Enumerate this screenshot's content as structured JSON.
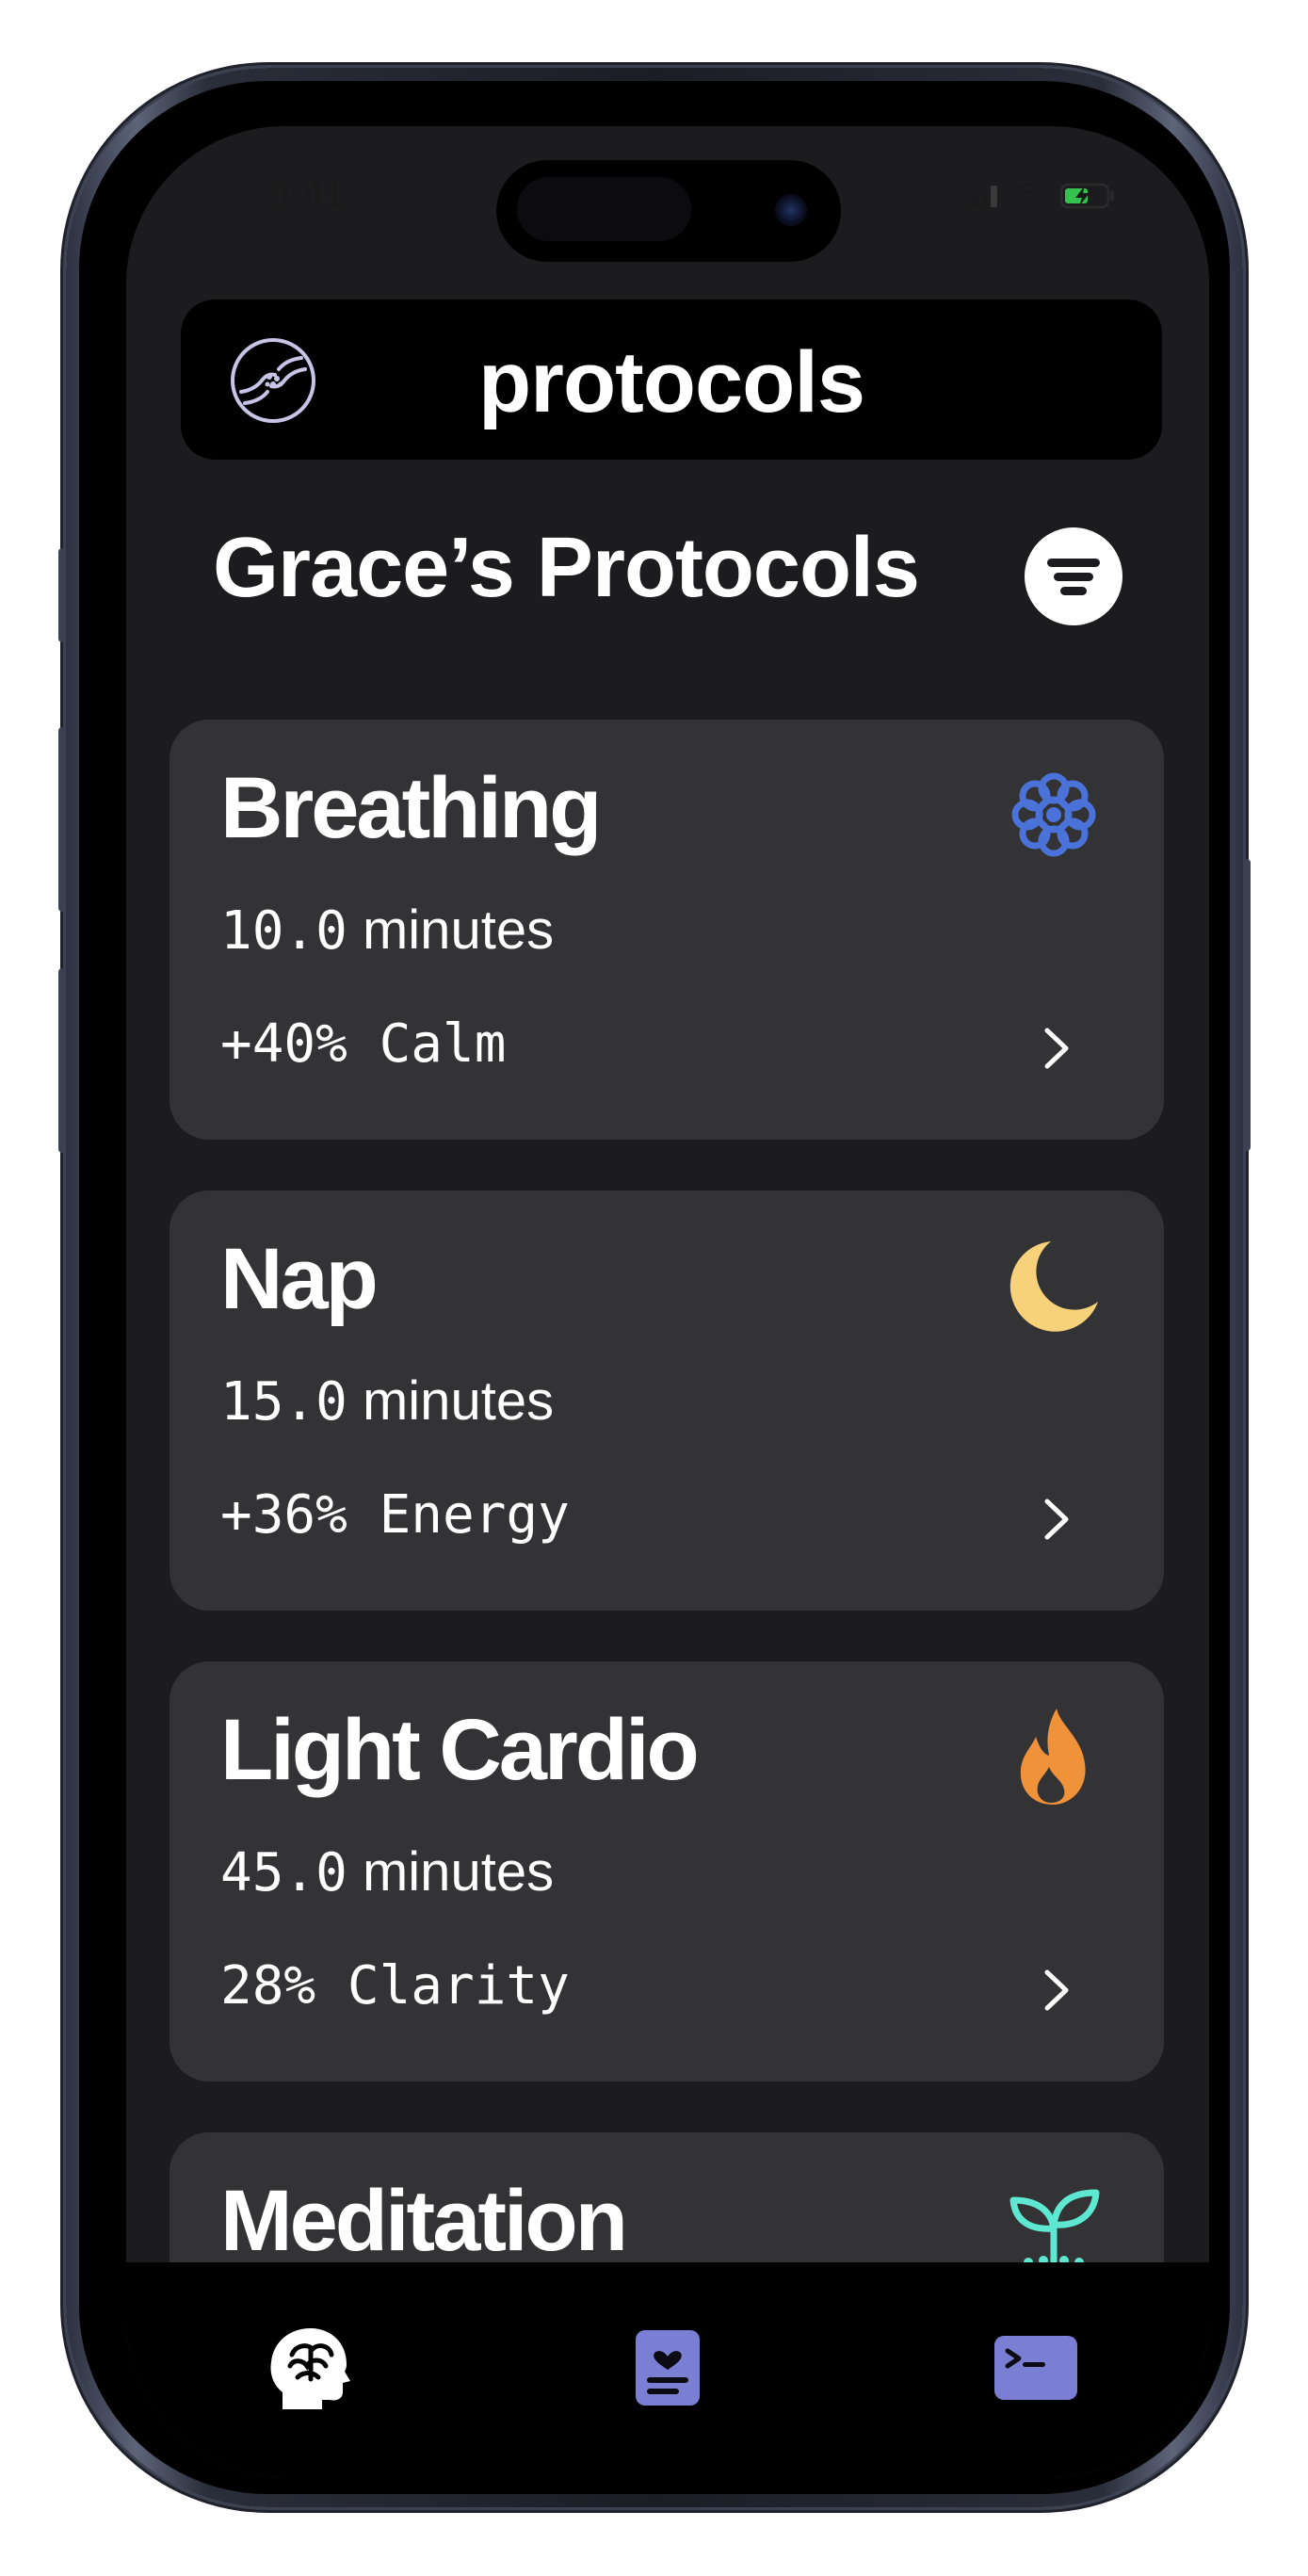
{
  "status_bar": {
    "time": "9:41",
    "icons": [
      "cellular-signal-icon",
      "wifi-icon",
      "battery-charging-icon"
    ]
  },
  "header": {
    "title": "protocols",
    "logo_icon": "brain-hands-logo-icon"
  },
  "page": {
    "title": "Grace’s Protocols",
    "filter_icon": "filter-lines-icon"
  },
  "protocols": [
    {
      "name": "Breathing",
      "duration_value": "10.0",
      "duration_unit": "minutes",
      "effect": "+40% Calm",
      "icon": "flower-icon",
      "icon_color": "#4a72d9"
    },
    {
      "name": "Nap",
      "duration_value": "15.0",
      "duration_unit": "minutes",
      "effect": "+36% Energy",
      "icon": "moon-icon",
      "icon_color": "#f7d27a"
    },
    {
      "name": "Light Cardio",
      "duration_value": "45.0",
      "duration_unit": "minutes",
      "effect": "28% Clarity",
      "icon": "flame-icon",
      "icon_color": "#f0923a"
    },
    {
      "name": "Meditation",
      "icon": "sprout-icon",
      "icon_color": "#5ee8d2"
    }
  ],
  "tab_bar": {
    "tabs": [
      {
        "icon": "brain-head-icon",
        "active": true
      },
      {
        "icon": "journal-heart-icon",
        "active": false
      },
      {
        "icon": "terminal-icon",
        "active": false
      }
    ],
    "accent_color": "#7b7fd4"
  },
  "colors": {
    "screen_background": "#1c1c1e",
    "card_background": "#333335",
    "header_background": "#000000"
  }
}
